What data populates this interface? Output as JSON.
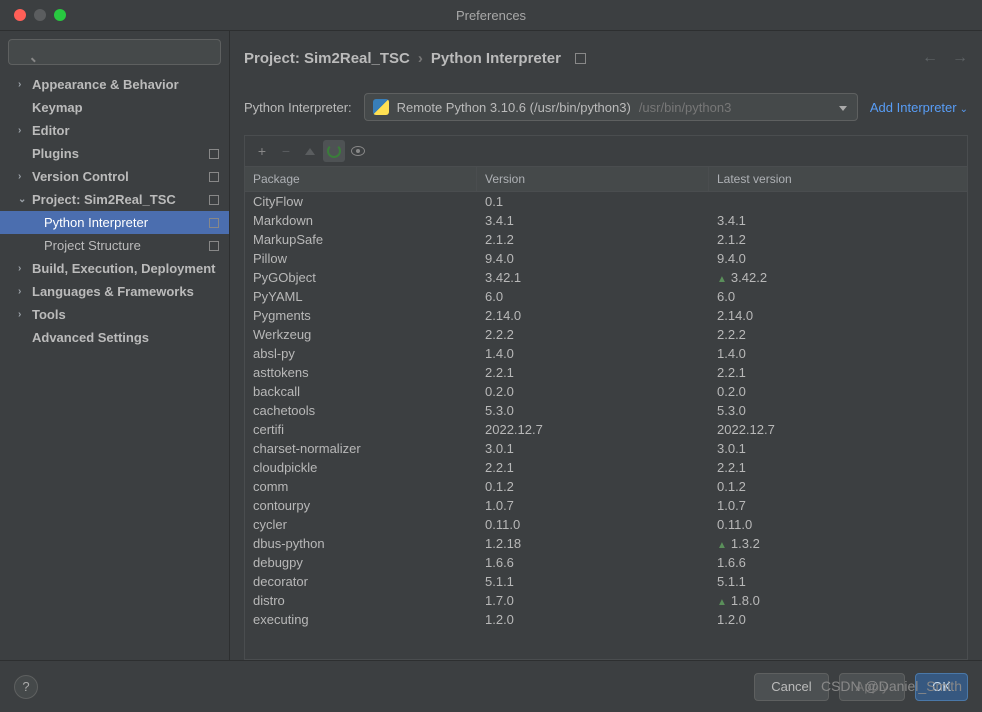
{
  "window": {
    "title": "Preferences"
  },
  "sidebar": {
    "search_placeholder": "",
    "items": [
      {
        "label": "Appearance & Behavior",
        "expandable": true,
        "expanded": false,
        "bold": true
      },
      {
        "label": "Keymap",
        "expandable": false,
        "bold": true,
        "plain": true
      },
      {
        "label": "Editor",
        "expandable": true,
        "expanded": false,
        "bold": true
      },
      {
        "label": "Plugins",
        "expandable": false,
        "bold": true,
        "plain": true,
        "badge": true
      },
      {
        "label": "Version Control",
        "expandable": true,
        "expanded": false,
        "bold": true,
        "badge": true
      },
      {
        "label": "Project: Sim2Real_TSC",
        "expandable": true,
        "expanded": true,
        "bold": true,
        "badge": true
      },
      {
        "label": "Python Interpreter",
        "sub": true,
        "selected": true,
        "badge": true
      },
      {
        "label": "Project Structure",
        "sub": true,
        "badge": true
      },
      {
        "label": "Build, Execution, Deployment",
        "expandable": true,
        "expanded": false,
        "bold": true
      },
      {
        "label": "Languages & Frameworks",
        "expandable": true,
        "expanded": false,
        "bold": true
      },
      {
        "label": "Tools",
        "expandable": true,
        "expanded": false,
        "bold": true
      },
      {
        "label": "Advanced Settings",
        "expandable": false,
        "bold": true,
        "plain": true
      }
    ]
  },
  "breadcrumb": {
    "parts": [
      "Project: Sim2Real_TSC",
      "Python Interpreter"
    ]
  },
  "interpreter": {
    "label": "Python Interpreter:",
    "selected": "Remote Python 3.10.6 (/usr/bin/python3)",
    "path_hint": "/usr/bin/python3",
    "add_link": "Add Interpreter"
  },
  "table": {
    "headers": [
      "Package",
      "Version",
      "Latest version"
    ],
    "rows": [
      {
        "pkg": "CityFlow",
        "ver": "0.1",
        "lat": ""
      },
      {
        "pkg": "Markdown",
        "ver": "3.4.1",
        "lat": "3.4.1"
      },
      {
        "pkg": "MarkupSafe",
        "ver": "2.1.2",
        "lat": "2.1.2"
      },
      {
        "pkg": "Pillow",
        "ver": "9.4.0",
        "lat": "9.4.0"
      },
      {
        "pkg": "PyGObject",
        "ver": "3.42.1",
        "lat": "3.42.2",
        "upgrade": true
      },
      {
        "pkg": "PyYAML",
        "ver": "6.0",
        "lat": "6.0"
      },
      {
        "pkg": "Pygments",
        "ver": "2.14.0",
        "lat": "2.14.0"
      },
      {
        "pkg": "Werkzeug",
        "ver": "2.2.2",
        "lat": "2.2.2"
      },
      {
        "pkg": "absl-py",
        "ver": "1.4.0",
        "lat": "1.4.0"
      },
      {
        "pkg": "asttokens",
        "ver": "2.2.1",
        "lat": "2.2.1"
      },
      {
        "pkg": "backcall",
        "ver": "0.2.0",
        "lat": "0.2.0"
      },
      {
        "pkg": "cachetools",
        "ver": "5.3.0",
        "lat": "5.3.0"
      },
      {
        "pkg": "certifi",
        "ver": "2022.12.7",
        "lat": "2022.12.7"
      },
      {
        "pkg": "charset-normalizer",
        "ver": "3.0.1",
        "lat": "3.0.1"
      },
      {
        "pkg": "cloudpickle",
        "ver": "2.2.1",
        "lat": "2.2.1"
      },
      {
        "pkg": "comm",
        "ver": "0.1.2",
        "lat": "0.1.2"
      },
      {
        "pkg": "contourpy",
        "ver": "1.0.7",
        "lat": "1.0.7"
      },
      {
        "pkg": "cycler",
        "ver": "0.11.0",
        "lat": "0.11.0"
      },
      {
        "pkg": "dbus-python",
        "ver": "1.2.18",
        "lat": "1.3.2",
        "upgrade": true
      },
      {
        "pkg": "debugpy",
        "ver": "1.6.6",
        "lat": "1.6.6"
      },
      {
        "pkg": "decorator",
        "ver": "5.1.1",
        "lat": "5.1.1"
      },
      {
        "pkg": "distro",
        "ver": "1.7.0",
        "lat": "1.8.0",
        "upgrade": true
      },
      {
        "pkg": "executing",
        "ver": "1.2.0",
        "lat": "1.2.0"
      }
    ]
  },
  "footer": {
    "cancel": "Cancel",
    "apply": "Apply",
    "ok": "OK"
  },
  "watermark": "CSDN @Daniel_Smith"
}
